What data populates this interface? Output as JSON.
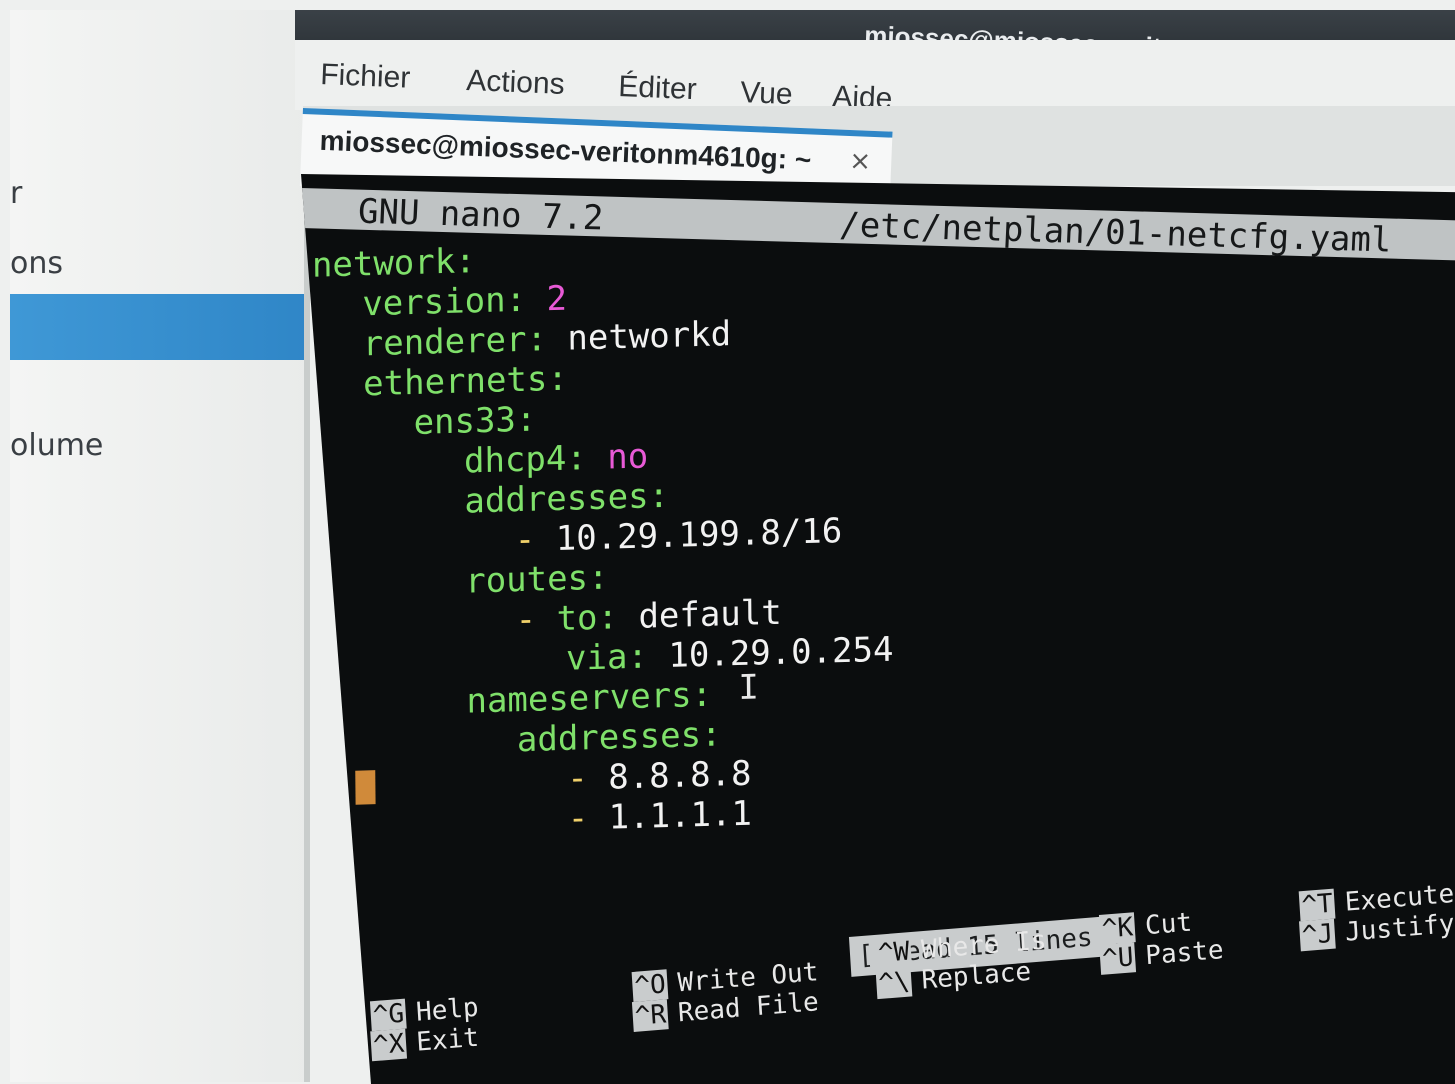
{
  "background_window": {
    "sidebar_fragments": [
      "r",
      "ons",
      "olume"
    ]
  },
  "terminal_window": {
    "title": "miossec@miossec-veritonm4610g: ~",
    "menu": [
      "Fichier",
      "Actions",
      "Éditer",
      "Vue",
      "Aide"
    ],
    "tab": {
      "label": "miossec@miossec-veritonm4610g: ~",
      "close": "×"
    }
  },
  "nano": {
    "header_left": "GNU nano 7.2",
    "header_file": "/etc/netplan/01-netcfg.yaml",
    "lines": [
      {
        "indent": 0,
        "key": "network:",
        "value": "",
        "value_color": "white"
      },
      {
        "indent": 1,
        "key": "version:",
        "value": "2",
        "value_color": "magenta"
      },
      {
        "indent": 1,
        "key": "renderer:",
        "value": "networkd",
        "value_color": "white"
      },
      {
        "indent": 1,
        "key": "ethernets:",
        "value": "",
        "value_color": "white"
      },
      {
        "indent": 2,
        "key": "ens33:",
        "value": "",
        "value_color": "white"
      },
      {
        "indent": 3,
        "key": "dhcp4:",
        "value": "no",
        "value_color": "magenta"
      },
      {
        "indent": 3,
        "key": "addresses:",
        "value": "",
        "value_color": "white"
      },
      {
        "indent": 4,
        "dash": "-",
        "key": "",
        "value": "10.29.199.8/16",
        "value_color": "white"
      },
      {
        "indent": 3,
        "key": "routes:",
        "value": "",
        "value_color": "white"
      },
      {
        "indent": 4,
        "dash": "-",
        "key": "to:",
        "value": "default",
        "value_color": "white"
      },
      {
        "indent": 5,
        "key": "via:",
        "value": "10.29.0.254",
        "value_color": "white"
      },
      {
        "indent": 3,
        "key": "nameservers:",
        "value": "",
        "value_color": "white"
      },
      {
        "indent": 4,
        "key": "addresses:",
        "value": "",
        "value_color": "white"
      },
      {
        "indent": 5,
        "dash": "-",
        "key": "",
        "value": "8.8.8.8",
        "value_color": "white"
      },
      {
        "indent": 5,
        "dash": "-",
        "key": "",
        "value": "1.1.1.1",
        "value_color": "white"
      }
    ],
    "status": "[ Read 15 lines ]",
    "shortcuts": [
      {
        "key": "^G",
        "label": "Help"
      },
      {
        "key": "^X",
        "label": "Exit"
      },
      {
        "key": "^O",
        "label": "Write Out"
      },
      {
        "key": "^R",
        "label": "Read File"
      },
      {
        "key": "^W",
        "label": "Where Is"
      },
      {
        "key": "^\\",
        "label": "Replace"
      },
      {
        "key": "^K",
        "label": "Cut"
      },
      {
        "key": "^U",
        "label": "Paste"
      },
      {
        "key": "^T",
        "label": "Execute"
      },
      {
        "key": "^J",
        "label": "Justify"
      }
    ]
  },
  "colors": {
    "key": "#7fe06a",
    "value_white": "#f2f2f2",
    "value_magenta": "#e85ad6",
    "dash": "#f0d06a",
    "selection_blue": "#2f86c7"
  }
}
